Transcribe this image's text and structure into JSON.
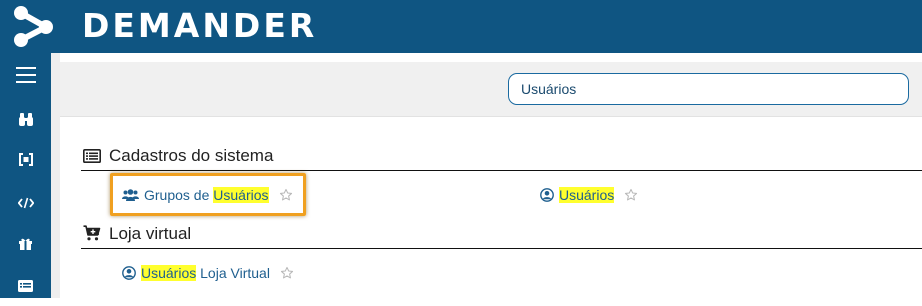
{
  "app": {
    "name": "DEMANDER",
    "brand_color": "#0f5582"
  },
  "sidebar": {
    "items": [
      {
        "icon": "hamburger-menu-icon"
      },
      {
        "icon": "binoculars-icon"
      },
      {
        "icon": "code-brackets-icon"
      },
      {
        "icon": "code-icon"
      },
      {
        "icon": "gift-icon"
      },
      {
        "icon": "list-icon"
      }
    ]
  },
  "search": {
    "value": "Usuários",
    "placeholder": ""
  },
  "sections": [
    {
      "title": "Cadastros do sistema",
      "icon": "list-alt-icon",
      "items": [
        {
          "icon": "users-icon",
          "prefix": "Grupos de ",
          "highlight": "Usuários",
          "suffix": "",
          "favorite": false,
          "focused": true
        },
        {
          "icon": "user-circle-icon",
          "prefix": "",
          "highlight": "Usuários",
          "suffix": "",
          "favorite": false,
          "focused": false
        }
      ]
    },
    {
      "title": "Loja virtual",
      "icon": "cart-plus-icon",
      "items": [
        {
          "icon": "user-circle-icon",
          "prefix": "",
          "highlight": "Usuários",
          "suffix": " Loja Virtual",
          "favorite": false,
          "focused": false
        }
      ]
    }
  ],
  "colors": {
    "highlight": "#ffff2e",
    "link": "#1f5f8f",
    "focus_outline": "#f0a020"
  }
}
